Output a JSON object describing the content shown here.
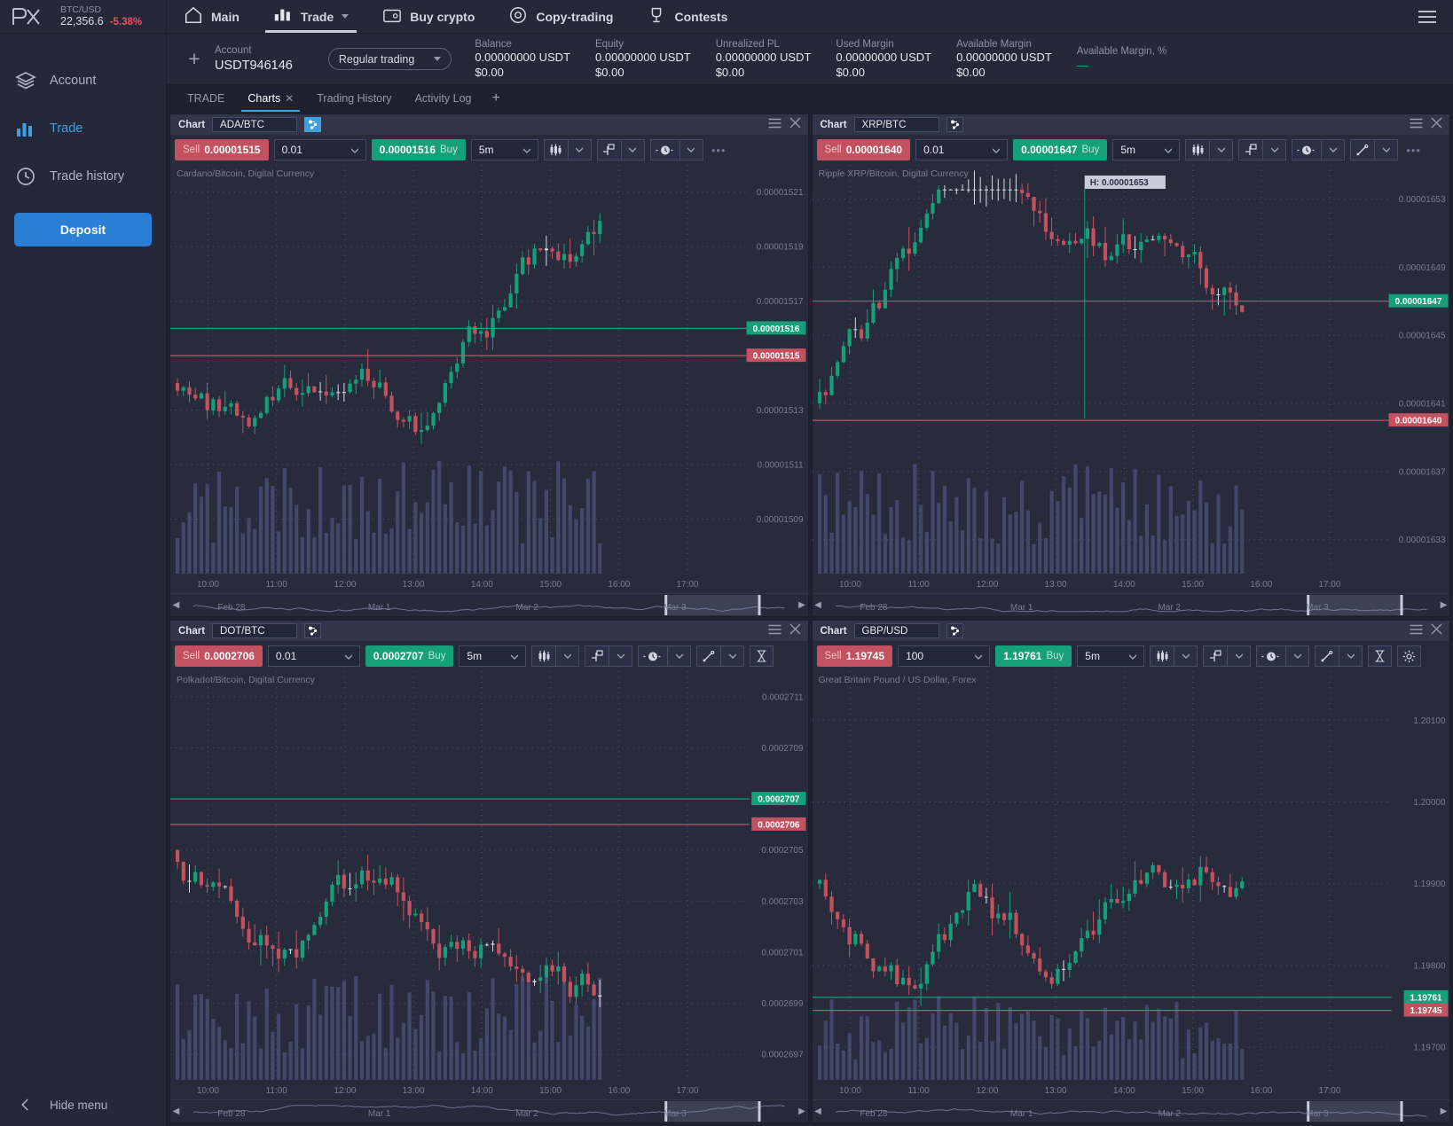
{
  "brand": {
    "logo": "px-logo",
    "ticker_symbol": "BTC/USD",
    "ticker_price": "22,356.6",
    "ticker_change": "-5.38%"
  },
  "sidebar": {
    "items": [
      {
        "label": "Account",
        "icon": "layers-icon",
        "active": false
      },
      {
        "label": "Trade",
        "icon": "bars-chart-icon",
        "active": true
      },
      {
        "label": "Trade history",
        "icon": "clock-icon",
        "active": false
      }
    ],
    "deposit_label": "Deposit",
    "hide_menu_label": "Hide menu"
  },
  "topnav": {
    "items": [
      {
        "label": "Main",
        "icon": "home-icon",
        "active": false,
        "caret": false
      },
      {
        "label": "Trade",
        "icon": "bars-chart-icon",
        "active": true,
        "caret": true
      },
      {
        "label": "Buy crypto",
        "icon": "wallet-icon",
        "active": false,
        "caret": false
      },
      {
        "label": "Copy-trading",
        "icon": "copy-icon",
        "active": false,
        "caret": false
      },
      {
        "label": "Contests",
        "icon": "trophy-icon",
        "active": false,
        "caret": false
      }
    ],
    "menu_icon": "hamburger-icon"
  },
  "account_bar": {
    "add_label": "+",
    "account_label": "Account",
    "account_value": "USDT946146",
    "mode": "Regular trading",
    "stats": [
      {
        "label": "Balance",
        "value": "0.00000000 USDT",
        "usd": "$0.00"
      },
      {
        "label": "Equity",
        "value": "0.00000000 USDT",
        "usd": "$0.00"
      },
      {
        "label": "Unrealized PL",
        "value": "0.00000000 USDT",
        "usd": "$0.00"
      },
      {
        "label": "Used Margin",
        "value": "0.00000000 USDT",
        "usd": "$0.00"
      },
      {
        "label": "Available Margin",
        "value": "0.00000000 USDT",
        "usd": "$0.00"
      },
      {
        "label": "Available Margin, %",
        "value": "—",
        "usd": ""
      }
    ]
  },
  "tabs": {
    "items": [
      {
        "label": "TRADE",
        "active": false,
        "closable": false
      },
      {
        "label": "Charts",
        "active": true,
        "closable": true
      },
      {
        "label": "Trading History",
        "active": false,
        "closable": false
      },
      {
        "label": "Activity Log",
        "active": false,
        "closable": false
      }
    ],
    "add_label": "+"
  },
  "panel_common": {
    "title": "Chart",
    "sell_word": "Sell",
    "buy_word": "Buy",
    "menu_icon": "hamburger-icon",
    "close_icon": "close-icon",
    "sync_icon": "sync-symbols-icon",
    "more_icon": "more-dots-icon",
    "candles_icon": "candlestick-icon",
    "indicator_icon": "indicator-icon",
    "time_icon": "clock-icon",
    "draw_icon": "trendline-icon",
    "measure_icon": "measure-icon",
    "settings_icon": "gear-icon",
    "caret_icon": "chevron-down-icon",
    "nav_left_icon": "chevron-left-icon",
    "nav_right_icon": "chevron-right-icon"
  },
  "charts": [
    {
      "id": "ada",
      "symbol": "ADA/BTC",
      "subtitle": "Cardano/Bitcoin, Digital Currency",
      "sell_price": "0.00001515",
      "buy_price": "0.00001516",
      "volume": "0.01",
      "timeframe": "5m",
      "sync_active": true,
      "show_draw": false,
      "show_measure": false,
      "show_settings": false,
      "show_more": true,
      "bid_tag": "0.00001515",
      "ask_tag": "0.00001516",
      "tooltip": null,
      "chart_data": {
        "type": "candlestick",
        "title": "ADA/BTC",
        "xlabel": "",
        "ylabel": "",
        "y_ticks": [
          "0.00001521",
          "0.00001519",
          "0.00001517",
          "0.00001515",
          "0.00001513",
          "0.00001511",
          "0.00001509"
        ],
        "ylim": [
          1.507e-05,
          1.522e-05
        ],
        "x_ticks": [
          "10:00",
          "11:00",
          "12:00",
          "13:00",
          "14:00",
          "15:00",
          "16:00",
          "17:00"
        ],
        "nav_ticks": [
          "Feb 28",
          "Mar 1",
          "Mar 2",
          "Mar 3"
        ],
        "price_lines": [
          {
            "value": "0.00001516",
            "color": "#16a07a"
          },
          {
            "value": "0.00001515",
            "color": "#c2525f"
          }
        ],
        "seed": 11,
        "base": 1.514e-05,
        "vol_height": 0.3
      }
    },
    {
      "id": "xrp",
      "symbol": "XRP/BTC",
      "subtitle": "Ripple XRP/Bitcoin, Digital Currency",
      "sell_price": "0.00001640",
      "buy_price": "0.00001647",
      "volume": "0.01",
      "timeframe": "5m",
      "sync_active": false,
      "show_draw": true,
      "show_measure": false,
      "show_settings": false,
      "show_more": true,
      "bid_tag": "0.00001640",
      "ask_tag": "0.00001647",
      "tooltip": "H: 0.00001653",
      "chart_data": {
        "type": "candlestick",
        "title": "XRP/BTC",
        "xlabel": "",
        "ylabel": "",
        "y_ticks": [
          "0.00001653",
          "0.00001649",
          "0.00001645",
          "0.00001641",
          "0.00001637",
          "0.00001633"
        ],
        "ylim": [
          1.631e-05,
          1.655e-05
        ],
        "x_ticks": [
          "10:00",
          "11:00",
          "12:00",
          "13:00",
          "14:00",
          "15:00",
          "16:00",
          "17:00"
        ],
        "nav_ticks": [
          "Feb 28",
          "Mar 1",
          "Mar 2",
          "Mar 3"
        ],
        "price_lines": [
          {
            "value": "0.00001647",
            "color": "#16a07a"
          },
          {
            "value": "0.00001640",
            "color": "#c2525f"
          }
        ],
        "seed": 29,
        "base": 1.641e-05,
        "vol_height": 0.3
      }
    },
    {
      "id": "dot",
      "symbol": "DOT/BTC",
      "subtitle": "Polkadot/Bitcoin, Digital Currency",
      "sell_price": "0.0002706",
      "buy_price": "0.0002707",
      "volume": "0.01",
      "timeframe": "5m",
      "sync_active": false,
      "show_draw": true,
      "show_measure": true,
      "show_settings": false,
      "show_more": false,
      "bid_tag": "0.0002706",
      "ask_tag": "0.0002707",
      "tooltip": null,
      "chart_data": {
        "type": "candlestick",
        "title": "DOT/BTC",
        "xlabel": "",
        "ylabel": "",
        "y_ticks": [
          "0.0002711",
          "0.0002709",
          "0.0002707",
          "0.0002705",
          "0.0002703",
          "0.0002701",
          "0.0002699",
          "0.0002697"
        ],
        "ylim": [
          0.0002696,
          0.0002712
        ],
        "x_ticks": [
          "10:00",
          "11:00",
          "12:00",
          "13:00",
          "14:00",
          "15:00",
          "16:00",
          "17:00"
        ],
        "nav_ticks": [
          "Feb 28",
          "Mar 1",
          "Mar 2",
          "Mar 3"
        ],
        "price_lines": [
          {
            "value": "0.0002707",
            "color": "#16a07a"
          },
          {
            "value": "0.0002706",
            "color": "#c2525f"
          }
        ],
        "seed": 43,
        "base": 0.0002705,
        "vol_height": 0.28
      }
    },
    {
      "id": "gbp",
      "symbol": "GBP/USD",
      "subtitle": "Great Britain Pound / US Dollar, Forex",
      "sell_price": "1.19745",
      "buy_price": "1.19761",
      "volume": "100",
      "timeframe": "5m",
      "sync_active": false,
      "show_draw": true,
      "show_measure": true,
      "show_settings": true,
      "show_more": false,
      "bid_tag": "1.19745",
      "ask_tag": "1.19761",
      "tooltip": null,
      "chart_data": {
        "type": "candlestick",
        "title": "GBP/USD",
        "xlabel": "",
        "ylabel": "",
        "y_ticks": [
          "1.20100",
          "1.20000",
          "1.19900",
          "1.19800",
          "1.19700"
        ],
        "ylim": [
          1.1966,
          1.2016
        ],
        "x_ticks": [
          "10:00",
          "11:00",
          "12:00",
          "13:00",
          "14:00",
          "15:00",
          "16:00",
          "17:00"
        ],
        "nav_ticks": [
          "Feb 28",
          "Mar 1",
          "Mar 2",
          "Mar 3"
        ],
        "price_lines": [
          {
            "value": "1.19761",
            "color": "#16a07a"
          },
          {
            "value": "1.19745",
            "color": "#c2525f"
          }
        ],
        "seed": 67,
        "base": 1.199,
        "vol_height": 0.22
      }
    }
  ],
  "colors": {
    "bg": "#1e2130",
    "panel": "#272b3b",
    "panel_head": "#303549",
    "accent": "#3f9fe0",
    "up": "#16a07a",
    "down": "#c2525f",
    "text": "#c8cbd9",
    "muted": "#777d95",
    "volume": "#474d73"
  }
}
